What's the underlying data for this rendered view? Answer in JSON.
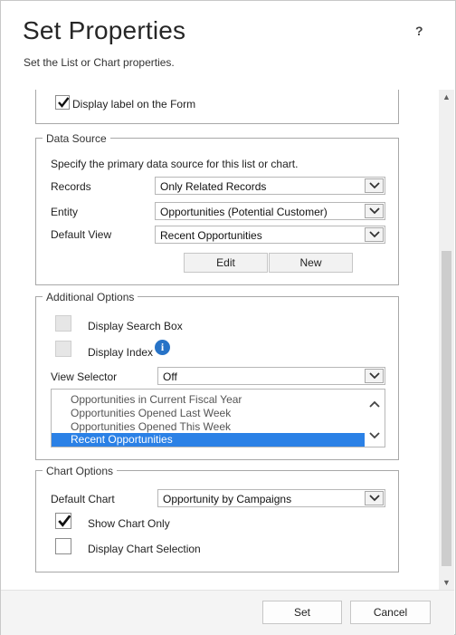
{
  "dialog": {
    "title": "Set Properties",
    "subtitle": "Set the List or Chart properties.",
    "help": "?"
  },
  "label_section": {
    "display_label_text": "Display label on the Form",
    "display_label_checked": true
  },
  "data_source": {
    "legend": "Data Source",
    "description": "Specify the primary data source for this list or chart.",
    "records_label": "Records",
    "records_value": "Only Related Records",
    "entity_label": "Entity",
    "entity_value": "Opportunities (Potential Customer)",
    "default_view_label": "Default View",
    "default_view_value": "Recent Opportunities",
    "edit_button": "Edit",
    "new_button": "New"
  },
  "additional_options": {
    "legend": "Additional Options",
    "display_search_box": "Display Search Box",
    "display_index": "Display Index",
    "view_selector_label": "View Selector",
    "view_selector_value": "Off",
    "views": [
      "Opportunities in Current Fiscal Year",
      "Opportunities Opened Last Week",
      "Opportunities Opened This Week",
      "Recent Opportunities"
    ],
    "selected_view": "Recent Opportunities"
  },
  "chart_options": {
    "legend": "Chart Options",
    "default_chart_label": "Default Chart",
    "default_chart_value": "Opportunity by Campaigns",
    "show_chart_only": "Show Chart Only",
    "show_chart_only_checked": true,
    "display_chart_selection": "Display Chart Selection",
    "display_chart_selection_checked": false
  },
  "footer": {
    "set_button": "Set",
    "cancel_button": "Cancel"
  },
  "colors": {
    "selection": "#2b81e6",
    "info_icon": "#2773c7"
  }
}
